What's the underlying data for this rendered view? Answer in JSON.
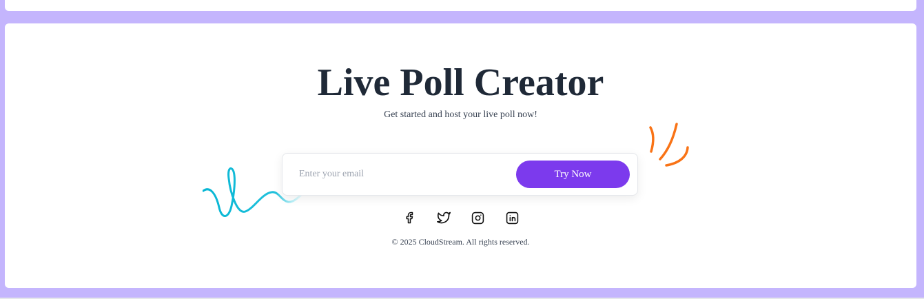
{
  "hero": {
    "title": "Live Poll Creator",
    "subtitle": "Get started and host your live poll now!"
  },
  "signup": {
    "email_placeholder": "Enter your email",
    "email_value": "",
    "button_label": "Try Now"
  },
  "socials": [
    "facebook-icon",
    "twitter-icon",
    "instagram-icon",
    "linkedin-icon"
  ],
  "footer": {
    "copyright": "© 2025 CloudStream. All rights reserved."
  },
  "colors": {
    "page_background": "#c4b5fd",
    "accent": "#7c3aed",
    "title": "#1f2937",
    "squiggle_left": "#06b6d4",
    "squiggle_right": "#f97316"
  }
}
